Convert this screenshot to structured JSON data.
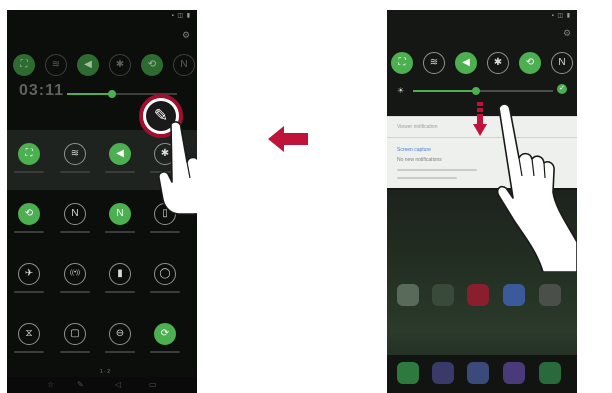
{
  "left_panel": {
    "status_icons": "▪ ◫ ▮",
    "clock": "03:11",
    "edit_button": {
      "icon": "pencil-icon",
      "highlight_color": "#a10e2e",
      "state": "highlighted"
    },
    "top_row": [
      {
        "icon": "screen-capture-icon",
        "on": true
      },
      {
        "icon": "wifi-icon",
        "on": false
      },
      {
        "icon": "sound-icon",
        "on": true
      },
      {
        "icon": "bluetooth-icon",
        "on": false
      },
      {
        "icon": "rotation-icon",
        "on": true
      },
      {
        "icon": "nfc-icon",
        "on": false
      }
    ],
    "grid": [
      [
        {
          "icon": "screen-capture-icon",
          "glyph": "⛶",
          "on": true
        },
        {
          "icon": "wifi-icon",
          "glyph": "≋",
          "on": false
        },
        {
          "icon": "sound-icon",
          "glyph": "◀",
          "on": true
        },
        {
          "icon": "bluetooth-icon",
          "glyph": "✱",
          "on": false
        }
      ],
      [
        {
          "icon": "auto-rotate-icon",
          "glyph": "⟲",
          "on": true
        },
        {
          "icon": "nfc-icon",
          "glyph": "N",
          "on": false
        },
        {
          "icon": "n-icon",
          "glyph": "N",
          "on": true
        },
        {
          "icon": "flashlight-icon",
          "glyph": "▯",
          "on": false
        }
      ],
      [
        {
          "icon": "airplane-mode-icon",
          "glyph": "✈",
          "on": false
        },
        {
          "icon": "hotspot-icon",
          "glyph": "((•))",
          "on": false
        },
        {
          "icon": "battery-saver-icon",
          "glyph": "▮",
          "on": false
        },
        {
          "icon": "ring-icon",
          "glyph": "◯",
          "on": false
        }
      ],
      [
        {
          "icon": "screen-share-icon",
          "glyph": "⧖",
          "on": false
        },
        {
          "icon": "book-icon",
          "glyph": "▢",
          "on": false
        },
        {
          "icon": "do-not-disturb-icon",
          "glyph": "⊖",
          "on": false
        },
        {
          "icon": "sync-icon",
          "glyph": "⟳",
          "on": true
        }
      ]
    ],
    "nav": {
      "page": "1 · 2"
    }
  },
  "right_panel": {
    "status_icons": "▪ ◫ ▮",
    "notification": {
      "title": "Viewer notification",
      "heading": "Screen capture",
      "label": "No new notifications"
    },
    "quick_row": [
      {
        "icon": "screen-capture-icon",
        "glyph": "⛶",
        "on": true
      },
      {
        "icon": "wifi-icon",
        "glyph": "≋",
        "on": false
      },
      {
        "icon": "sound-icon",
        "glyph": "◀",
        "on": true
      },
      {
        "icon": "bluetooth-icon",
        "glyph": "✱",
        "on": false
      },
      {
        "icon": "auto-rotate-icon",
        "glyph": "⟲",
        "on": true
      },
      {
        "icon": "nfc-icon",
        "glyph": "N",
        "on": false
      }
    ],
    "brightness": {
      "fraction": 0.45,
      "auto": true
    },
    "app_rows": [
      [
        {
          "icon": "folder-icon",
          "color": "#5a6a5a"
        },
        {
          "icon": "play-store-icon",
          "color": "#3a4a3a"
        },
        {
          "icon": "pen-app-icon",
          "color": "#8a1e2e"
        },
        {
          "icon": "chrome-icon",
          "color": "#3a5a9a"
        },
        {
          "icon": "settings-app-icon",
          "color": "#4a4f4a"
        }
      ],
      [
        {
          "icon": "phone-app-icon",
          "color": "#2e7a3e"
        },
        {
          "icon": "messages-app-icon",
          "color": "#3a3a6a"
        },
        {
          "icon": "camera-app-icon",
          "color": "#3a4a7a"
        },
        {
          "icon": "gallery-app-icon",
          "color": "#4a3a7a"
        },
        {
          "icon": "chrome-app-icon",
          "color": "#2a6a3a"
        }
      ]
    ]
  },
  "colors": {
    "accent": "#4caf50",
    "highlight": "#a10e2e"
  }
}
